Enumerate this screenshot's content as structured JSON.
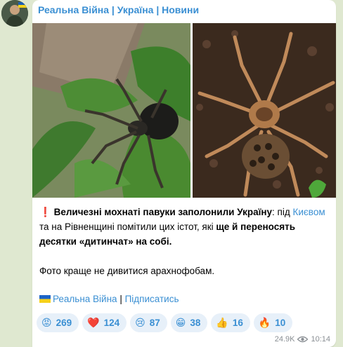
{
  "channel": {
    "name": "Реальна Війна | Україна | Новини"
  },
  "post": {
    "alert_icon": "❗",
    "headline_bold": "Величезні мохнаті павуки заполонили Україну",
    "colon": ": під ",
    "city_link": "Києвом",
    "text_mid": " та на Рівненщині помітили цих істот, які ",
    "bold_end": "ще й переносять десятки «дитинчат» на собі.",
    "paragraph2": "Фото краще не дивитися арахнофобам."
  },
  "footer": {
    "channel_link": "Реальна Війна",
    "separator": " | ",
    "subscribe_link": "Підписатись"
  },
  "reactions": [
    {
      "emoji": "😡",
      "count": "269"
    },
    {
      "emoji": "❤️",
      "count": "124"
    },
    {
      "emoji": "😢",
      "count": "87"
    },
    {
      "emoji": "😁",
      "count": "38"
    },
    {
      "emoji": "👍",
      "count": "16"
    },
    {
      "emoji": "🔥",
      "count": "10"
    }
  ],
  "meta": {
    "views": "24.9K",
    "time": "10:14"
  },
  "colors": {
    "accent": "#3a8fd3",
    "background": "#dfe8d0",
    "reaction_bg": "#e7f0f9"
  }
}
